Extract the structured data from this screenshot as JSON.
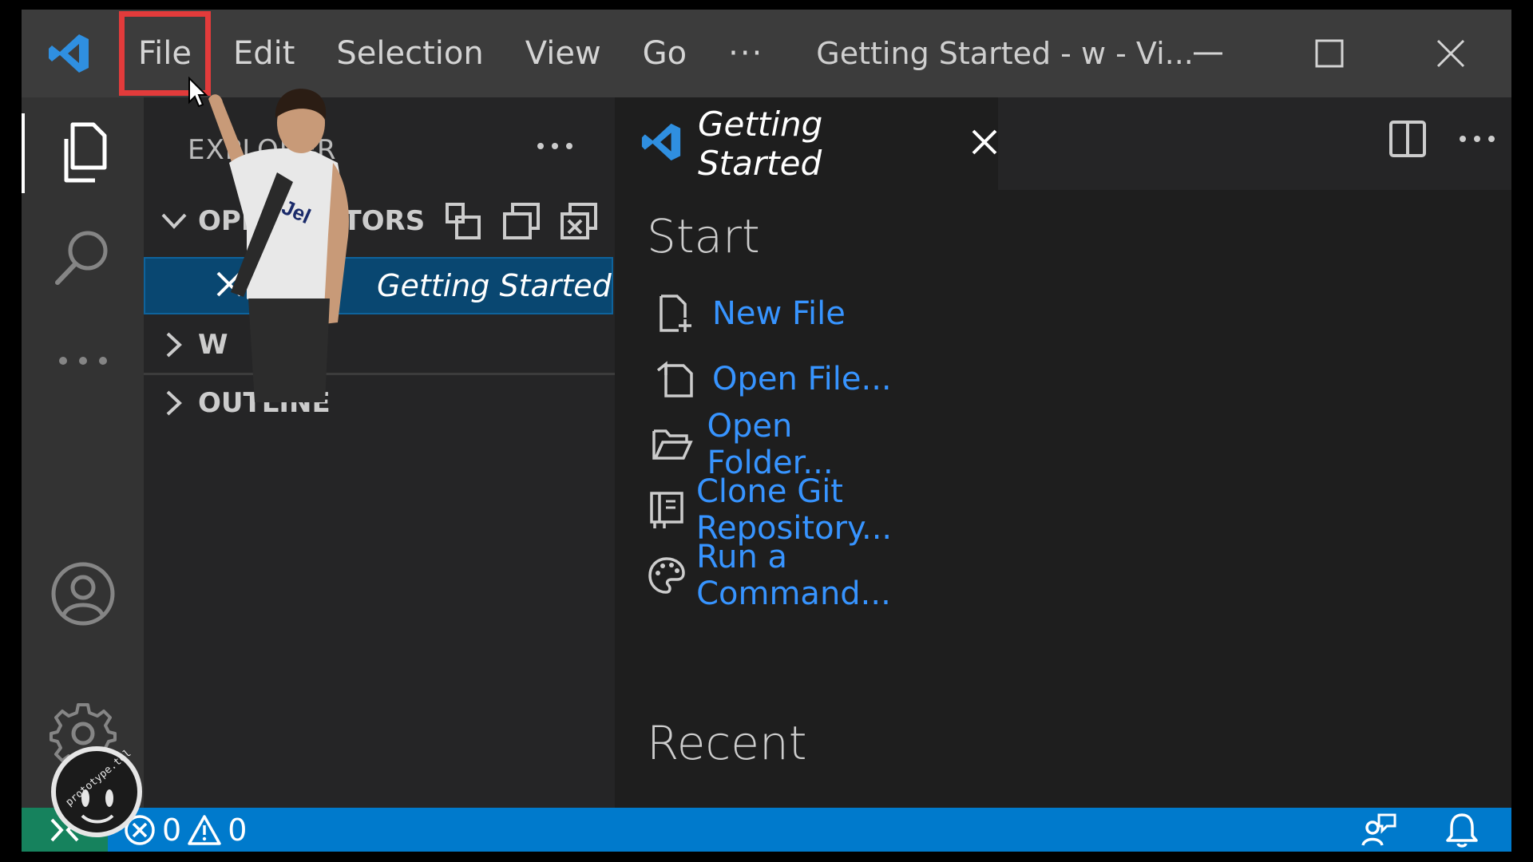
{
  "titlebar": {
    "menu": [
      "File",
      "Edit",
      "Selection",
      "View",
      "Go"
    ],
    "more": "···",
    "window_title": "Getting Started - w - Vi..."
  },
  "sidebar": {
    "title": "EXPLORER",
    "open_editors_label": "OPEN EDITORS",
    "open_editor_item": "Getting Started",
    "workspace_label": "W",
    "outline_label": "OUTLINE"
  },
  "editor": {
    "tab_label": "Getting Started",
    "start_heading": "Start",
    "actions": [
      {
        "label": "New File",
        "icon": "new-file-icon"
      },
      {
        "label": "Open File...",
        "icon": "open-file-icon"
      },
      {
        "label": "Open Folder...",
        "icon": "open-folder-icon"
      },
      {
        "label": "Clone Git Repository...",
        "icon": "clone-repo-icon"
      },
      {
        "label": "Run a Command...",
        "icon": "palette-icon"
      }
    ],
    "recent_heading": "Recent"
  },
  "statusbar": {
    "errors": "0",
    "warnings": "0"
  },
  "overlay": {
    "shirt_text": "Jel",
    "badge_text": "prototype.tel"
  },
  "colors": {
    "accent": "#007acc",
    "link": "#3794ff",
    "highlight_box": "#e23b3b",
    "remote": "#16825d"
  }
}
